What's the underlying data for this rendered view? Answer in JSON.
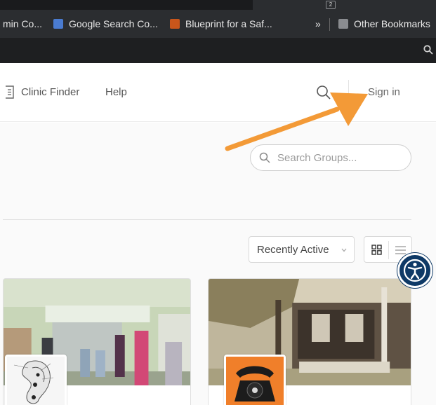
{
  "browser": {
    "tab_badge": "2",
    "bookmarks": [
      {
        "label": "min Co...",
        "icon": "text-icon"
      },
      {
        "label": "Google Search Co...",
        "icon": "search-console-icon"
      },
      {
        "label": "Blueprint for a Saf...",
        "icon": "all-icon"
      }
    ],
    "overflow": "»",
    "other_bookmarks": "Other Bookmarks"
  },
  "header": {
    "nav": [
      {
        "label": "Clinic Finder"
      },
      {
        "label": "Help"
      }
    ],
    "sign_in": "Sign in"
  },
  "groups": {
    "search_placeholder": "Search Groups...",
    "sort_selected": "Recently Active"
  },
  "colors": {
    "arrow": "#f39a37",
    "accessibility": "#0e3966"
  }
}
